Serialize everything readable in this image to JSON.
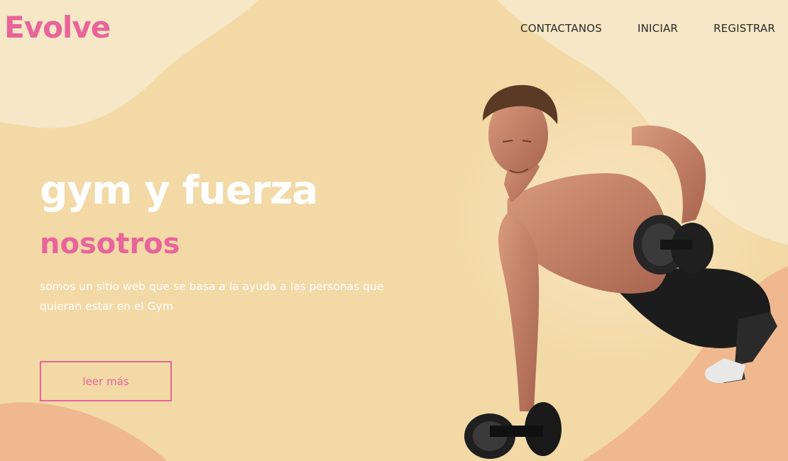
{
  "brand": {
    "logo_text": "Evolve",
    "accent_color": "#e8649a"
  },
  "nav": {
    "items": [
      {
        "label": "CONTACTANOS"
      },
      {
        "label": "INICIAR"
      },
      {
        "label": "REGISTRAR"
      }
    ]
  },
  "hero": {
    "title": "gym y fuerza",
    "subtitle": "nosotros",
    "description": "somos un sitio web que se basa a la ayuda a las personas que quieran estar en el Gym",
    "cta_label": "leer más"
  },
  "colors": {
    "background": "#f2d9a6",
    "blob_light": "#f6e7c6",
    "blob_peach": "#efb88f",
    "title_color": "#ffffff",
    "nav_text": "#2a2a2a"
  },
  "image": {
    "subject": "athlete-dumbbell-pushup-photo"
  }
}
